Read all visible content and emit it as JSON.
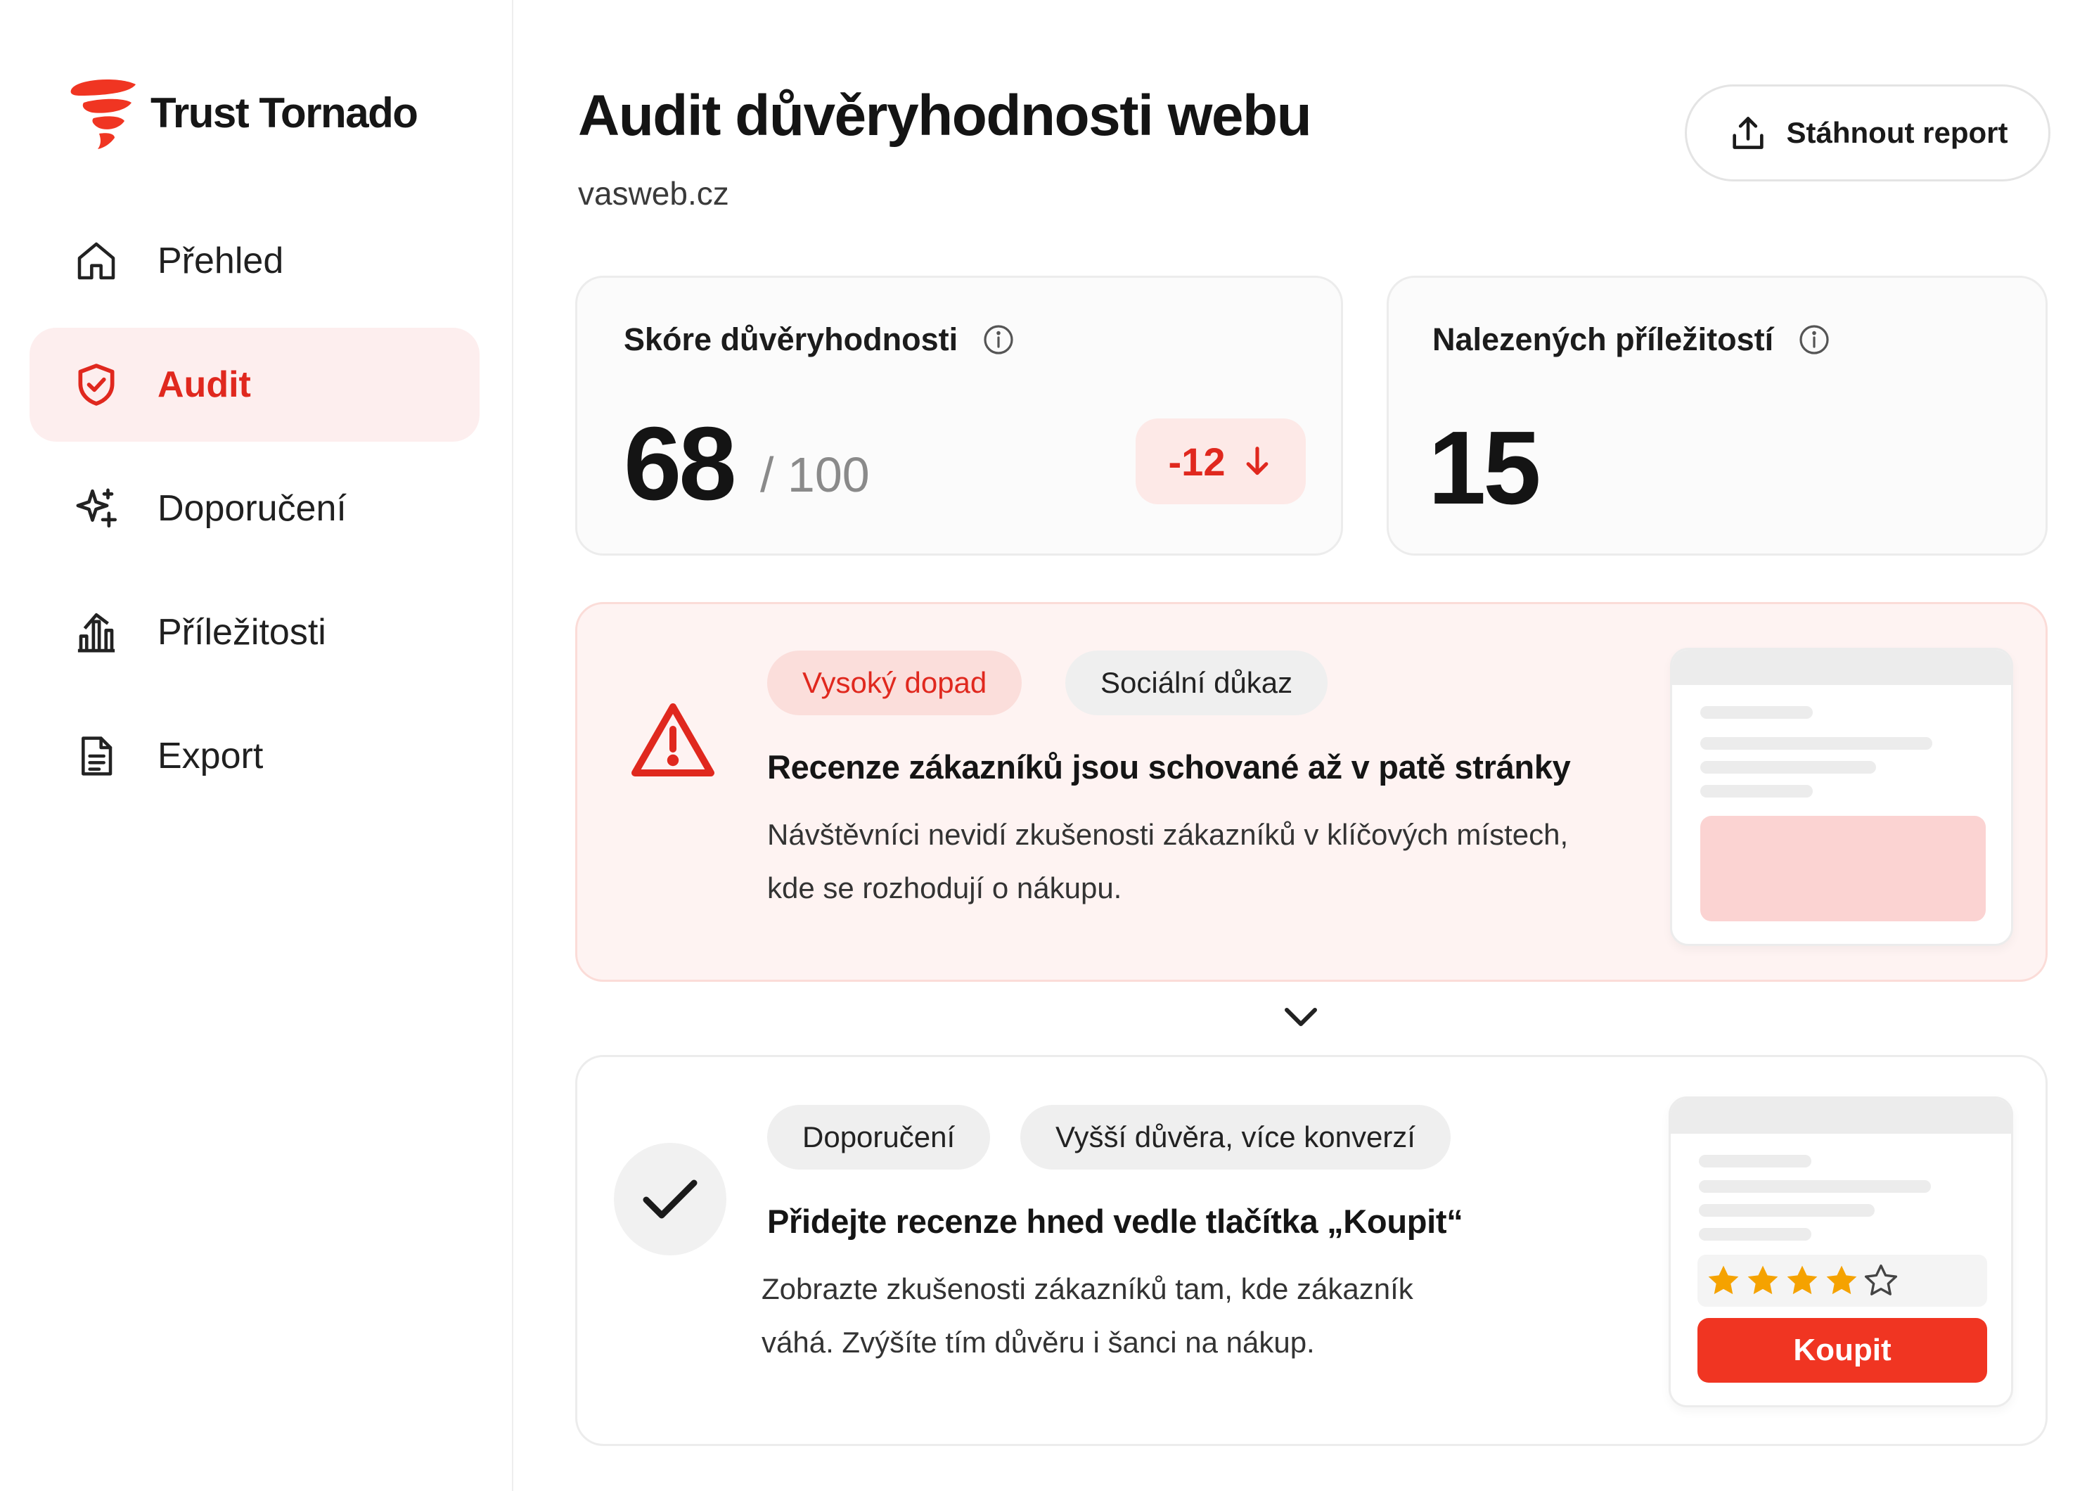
{
  "brand": {
    "name": "Trust Tornado",
    "color": "#f03522"
  },
  "sidebar": {
    "items": [
      {
        "label": "Přehled",
        "icon": "home-icon",
        "active": false
      },
      {
        "label": "Audit",
        "icon": "shield-check-icon",
        "active": true
      },
      {
        "label": "Doporučení",
        "icon": "sparkles-icon",
        "active": false
      },
      {
        "label": "Příležitosti",
        "icon": "bar-chart-icon",
        "active": false
      },
      {
        "label": "Export",
        "icon": "document-icon",
        "active": false
      }
    ]
  },
  "header": {
    "title": "Audit důvěryhodnosti webu",
    "domain": "vasweb.cz",
    "download_label": "Stáhnout report"
  },
  "score_card": {
    "label": "Skóre důvěryhodnosti",
    "value": "68",
    "max": "/ 100",
    "delta": "-12"
  },
  "opportunities_card": {
    "label": "Nalezených příležitostí",
    "value": "15"
  },
  "issue": {
    "tags": [
      "Vysoký dopad",
      "Sociální důkaz"
    ],
    "title": "Recenze zákazníků jsou schované až v patě stránky",
    "description_line1": "Návštěvníci nevidí zkušenosti zákazníků v klíčových místech,",
    "description_line2": "kde se rozhodují o nákupu."
  },
  "recommendation": {
    "tags": [
      "Doporučení",
      "Vyšší důvěra, více konverzí"
    ],
    "title": "Přidejte recenze hned vedle tlačítka „Koupit“",
    "description_line1": "Zobrazte zkušenosti zákazníků tam, kde zákazník",
    "description_line2": "váhá. Zvýšíte tím důvěru i šanci na nákup.",
    "rating_stars": 4,
    "rating_max": 5,
    "buy_label": "Koupit"
  },
  "colors": {
    "accent": "#e0281e",
    "star": "#f5a200"
  }
}
